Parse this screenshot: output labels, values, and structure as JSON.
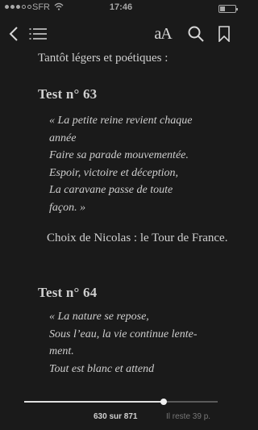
{
  "status": {
    "carrier": "SFR",
    "time": "17:46",
    "signal_bars_filled": 3,
    "signal_bars_total": 5
  },
  "toolbar": {
    "back_icon": "chevron-left-icon",
    "toc_icon": "list-icon",
    "font_size_label": "aA",
    "search_icon": "search-icon",
    "bookmark_icon": "bookmark-icon"
  },
  "content": {
    "intro": "Tantôt légers et poétiques :",
    "sections": [
      {
        "heading": "Test n° 63",
        "lines": [
          "« La petite reine revient chaque",
          "année",
          "Faire sa parade mouvementée.",
          "Espoir, victoire et déception,",
          "La caravane passe de toute",
          "façon. »"
        ]
      },
      {
        "heading": "Test n° 64",
        "lines": [
          "« La nature se repose,",
          "Sous l’eau, la vie continue lente-",
          "ment.",
          "Tout est blanc et attend"
        ]
      }
    ],
    "paragraph": "Choix de Nicolas : le Tour de France."
  },
  "footer": {
    "progress": 0.72,
    "page_position": "630 sur 871",
    "pages_remaining": "Il reste 39 p."
  },
  "colors": {
    "background": "#1a1a1a",
    "text": "#cfcfcf",
    "icons": "#d8d8d8",
    "muted": "#777777"
  }
}
